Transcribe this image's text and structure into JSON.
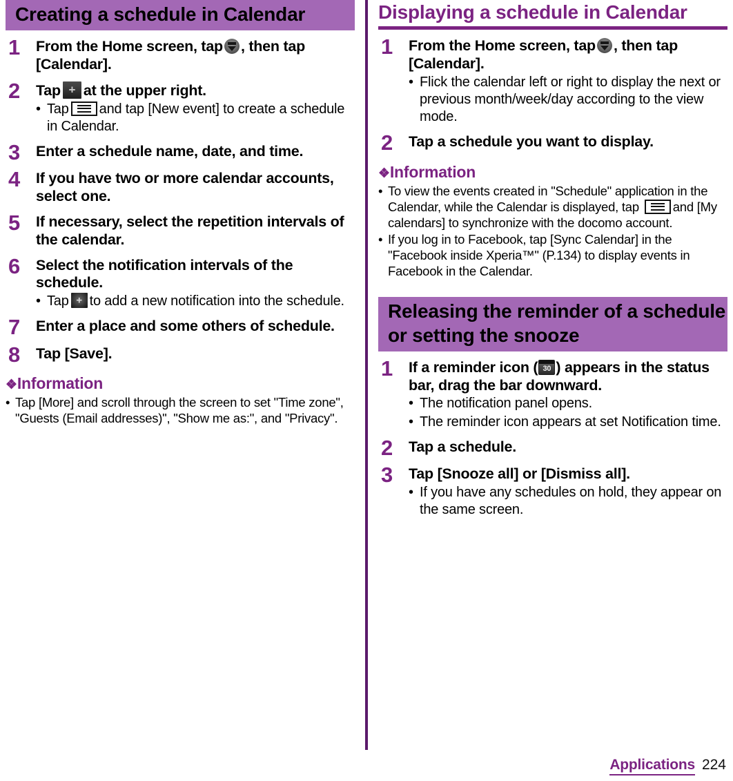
{
  "page": {
    "footer_label": "Applications",
    "footer_page": "224",
    "accent_bar": "#A368B5",
    "accent_text": "#7B2382",
    "divider_color": "#5B1A6B"
  },
  "left_column": {
    "heading": "Creating a schedule in Calendar",
    "steps": [
      {
        "number": "1",
        "title_before": "From the Home screen, tap",
        "icon": "app-drawer-icon",
        "title_after": ", then tap [Calendar].",
        "bullets": []
      },
      {
        "number": "2",
        "title_before": "Tap",
        "icon": "plus-button-icon",
        "title_after": "at the upper right.",
        "bullets": [
          {
            "dot": "•",
            "before": "Tap",
            "icon": "menu-button-icon",
            "after": "and tap [New event] to create a schedule in Calendar."
          }
        ]
      },
      {
        "number": "3",
        "title_before": "Enter a schedule name, date, and time.",
        "icon": "",
        "title_after": "",
        "bullets": []
      },
      {
        "number": "4",
        "title_before": "If you have two or more calendar accounts, select one.",
        "icon": "",
        "title_after": "",
        "bullets": []
      },
      {
        "number": "5",
        "title_before": "If necessary, select the repetition intervals of the calendar.",
        "icon": "",
        "title_after": "",
        "bullets": []
      },
      {
        "number": "6",
        "title_before": "Select the notification intervals of the schedule.",
        "icon": "",
        "title_after": "",
        "bullets": [
          {
            "dot": "•",
            "before": "Tap",
            "icon": "plus-small-icon",
            "after": "to add a new notification into the schedule."
          }
        ]
      },
      {
        "number": "7",
        "title_before": "Enter a place and some others of schedule.",
        "icon": "",
        "title_after": "",
        "bullets": []
      },
      {
        "number": "8",
        "title_before": "Tap [Save].",
        "icon": "",
        "title_after": "",
        "bullets": []
      }
    ],
    "information": {
      "diamonds": "❖",
      "label": "Information",
      "items": [
        {
          "dot": "•",
          "text": "Tap [More] and scroll through the screen to set \"Time zone\", \"Guests (Email addresses)\", \"Show me as:\", and \"Privacy\"."
        }
      ]
    }
  },
  "right_column": {
    "heading_1": "Displaying a schedule in Calendar",
    "steps_1": [
      {
        "number": "1",
        "title_before": "From the Home screen, tap",
        "icon": "app-drawer-icon",
        "title_after": ", then tap [Calendar].",
        "bullets": [
          {
            "dot": "•",
            "text": "Flick the calendar left or right to display the next or previous month/week/day according to the view mode."
          }
        ]
      },
      {
        "number": "2",
        "title_before": "Tap a schedule you want to display.",
        "icon": "",
        "title_after": "",
        "bullets": []
      }
    ],
    "information": {
      "diamonds": "❖",
      "label": "Information",
      "item_1_before": "To view the events created in \"Schedule\" application in the Calendar, while the Calendar is displayed, tap",
      "item_1_icon": "menu-button-icon",
      "item_1_after": "and [My calendars] to synchronize with the docomo account.",
      "item_2": "If you log in to Facebook, tap [Sync Calendar] in the \"Facebook inside Xperia™\" (P.134) to display events in Facebook in the Calendar."
    },
    "heading_2": "Releasing the reminder of a schedule or setting the snooze",
    "steps_2": [
      {
        "number": "1",
        "title_before": "If a reminder icon (",
        "icon": "reminder-calendar-icon",
        "icon_label": "30",
        "title_after": ") appears in the status bar, drag the bar downward.",
        "bullets": [
          {
            "dot": "•",
            "text": "The notification panel opens."
          },
          {
            "dot": "•",
            "text": "The reminder icon appears at set Notification time."
          }
        ]
      },
      {
        "number": "2",
        "title_before": "Tap a schedule.",
        "icon": "",
        "title_after": "",
        "bullets": []
      },
      {
        "number": "3",
        "title_before": "Tap [Snooze all] or [Dismiss all].",
        "icon": "",
        "title_after": "",
        "bullets": [
          {
            "dot": "•",
            "text": "If you have any schedules on hold, they appear on the same screen."
          }
        ]
      }
    ]
  }
}
